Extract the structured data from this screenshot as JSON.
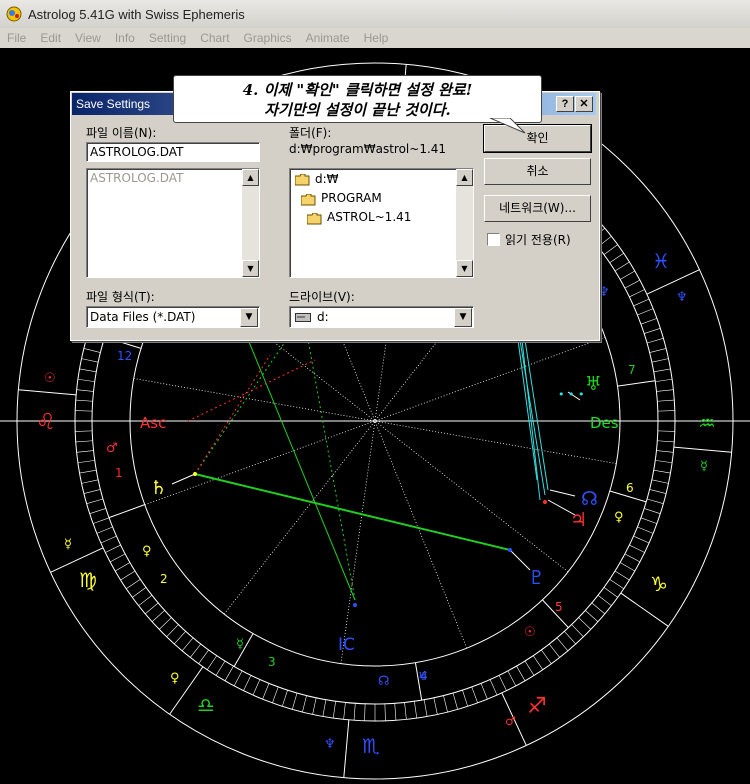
{
  "window": {
    "title": "Astrolog 5.41G with Swiss Ephemeris"
  },
  "menu": [
    "File",
    "Edit",
    "View",
    "Info",
    "Setting",
    "Chart",
    "Graphics",
    "Animate",
    "Help"
  ],
  "chart": {
    "house_numbers": [
      {
        "label": "12",
        "color": "#2f4fff"
      },
      {
        "label": "1",
        "color": "#ff2a2a"
      },
      {
        "label": "2",
        "color": "#ffff3a"
      },
      {
        "label": "3",
        "color": "#22cc22"
      },
      {
        "label": "4",
        "color": "#3a5aff"
      },
      {
        "label": "5",
        "color": "#ff3a3a"
      },
      {
        "label": "6",
        "color": "#ffff40"
      },
      {
        "label": "7",
        "color": "#22cc22"
      }
    ],
    "angle_labels": {
      "asc": "Asc",
      "des": "Des",
      "ic": "IC"
    },
    "glyphs": {
      "leo": "♌",
      "virgo": "♍",
      "libra": "♎",
      "scorpio": "♏",
      "sagittarius": "♐",
      "aquarius": "♒",
      "pisces": "♓",
      "saturn": "♄",
      "pluto": "♇",
      "venus": "♀",
      "mercury": "☿",
      "mars": "♂",
      "jupiter": "♃",
      "sun": "☉",
      "neptune": "♆",
      "uranus": "♅",
      "node": "☊"
    },
    "colors": {
      "fire": "#ff3030",
      "earth": "#ffff30",
      "air": "#30e030",
      "water": "#3050ff",
      "ring": "#ffffff"
    }
  },
  "dialog": {
    "title": "Save Settings",
    "help_button": "?",
    "close_button": "✕",
    "filename_label": "파일 이름(N):",
    "filename_value": "ASTROLOG.DAT",
    "file_list": [
      "ASTROLOG.DAT"
    ],
    "folder_label": "폴더(F):",
    "folder_path": "d:₩program₩astrol~1.41",
    "folder_tree": [
      "d:₩",
      "PROGRAM",
      "ASTROL~1.41"
    ],
    "filetype_label": "파일 형식(T):",
    "filetype_value": "Data Files (*.DAT)",
    "drive_label": "드라이브(V):",
    "drive_value": "d:",
    "ok_button": "확인",
    "cancel_button": "취소",
    "network_button": "네트워크(W)...",
    "readonly_label": "읽기 전용(R)"
  },
  "callout": {
    "line1": "4. 이제 \"확인\" 클릭하면 설정 완료!",
    "line2": "자기만의 설정이 끝난 것이다."
  }
}
